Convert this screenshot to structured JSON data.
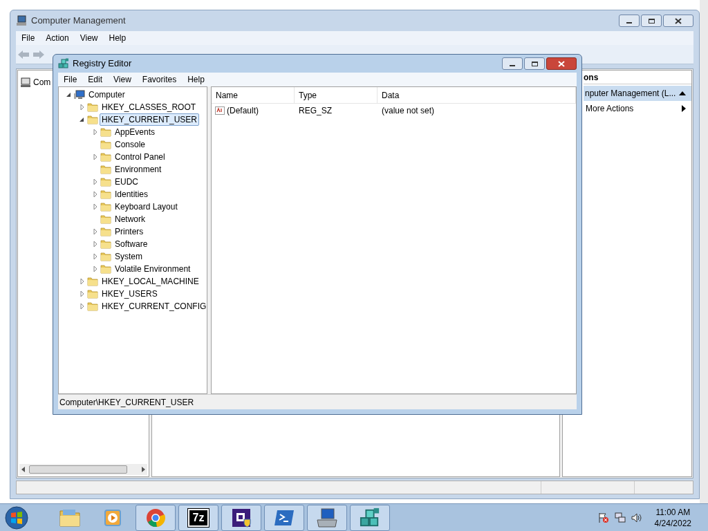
{
  "computer_management": {
    "title": "Computer Management",
    "menu": [
      "File",
      "Action",
      "View",
      "Help"
    ],
    "tree": [
      {
        "label": "Com"
      }
    ],
    "actions": {
      "header": "ons",
      "items": [
        {
          "kind": "group",
          "label": "nputer Management (L...",
          "expanded": true
        },
        {
          "kind": "submenu",
          "label": "More Actions"
        }
      ]
    }
  },
  "registry_editor": {
    "title": "Registry Editor",
    "menu": [
      "File",
      "Edit",
      "View",
      "Favorites",
      "Help"
    ],
    "tree": [
      {
        "label": "Computer",
        "expandable": true,
        "expanded": true,
        "selected": false,
        "children": [
          {
            "label": "HKEY_CLASSES_ROOT",
            "expandable": true,
            "expanded": false,
            "selected": false
          },
          {
            "label": "HKEY_CURRENT_USER",
            "expandable": true,
            "expanded": true,
            "selected": true,
            "children": [
              {
                "label": "AppEvents",
                "expandable": true,
                "expanded": false,
                "selected": false
              },
              {
                "label": "Console",
                "expandable": false,
                "expanded": false,
                "selected": false
              },
              {
                "label": "Control Panel",
                "expandable": true,
                "expanded": false,
                "selected": false
              },
              {
                "label": "Environment",
                "expandable": false,
                "expanded": false,
                "selected": false
              },
              {
                "label": "EUDC",
                "expandable": true,
                "expanded": false,
                "selected": false
              },
              {
                "label": "Identities",
                "expandable": true,
                "expanded": false,
                "selected": false
              },
              {
                "label": "Keyboard Layout",
                "expandable": true,
                "expanded": false,
                "selected": false
              },
              {
                "label": "Network",
                "expandable": false,
                "expanded": false,
                "selected": false
              },
              {
                "label": "Printers",
                "expandable": true,
                "expanded": false,
                "selected": false
              },
              {
                "label": "Software",
                "expandable": true,
                "expanded": false,
                "selected": false
              },
              {
                "label": "System",
                "expandable": true,
                "expanded": false,
                "selected": false
              },
              {
                "label": "Volatile Environment",
                "expandable": true,
                "expanded": false,
                "selected": false
              }
            ]
          },
          {
            "label": "HKEY_LOCAL_MACHINE",
            "expandable": true,
            "expanded": false,
            "selected": false
          },
          {
            "label": "HKEY_USERS",
            "expandable": true,
            "expanded": false,
            "selected": false
          },
          {
            "label": "HKEY_CURRENT_CONFIG",
            "expandable": true,
            "expanded": false,
            "selected": false
          }
        ]
      }
    ],
    "columns": [
      "Name",
      "Type",
      "Data"
    ],
    "rows": [
      {
        "name": "(Default)",
        "type": "REG_SZ",
        "data": "(value not set)"
      }
    ],
    "status": "Computer\\HKEY_CURRENT_USER"
  },
  "taskbar": {
    "apps": [
      {
        "kind": "folder",
        "running": false
      },
      {
        "kind": "media",
        "running": false
      },
      {
        "kind": "browser",
        "running": true
      },
      {
        "kind": "archiver",
        "label": "7z",
        "running": true
      },
      {
        "kind": "chip",
        "running": true
      },
      {
        "kind": "shell",
        "running": true
      },
      {
        "kind": "computer",
        "running": true
      },
      {
        "kind": "registry",
        "running": true
      }
    ],
    "clock": {
      "time": "11:00 AM",
      "date": "4/24/2022"
    }
  }
}
